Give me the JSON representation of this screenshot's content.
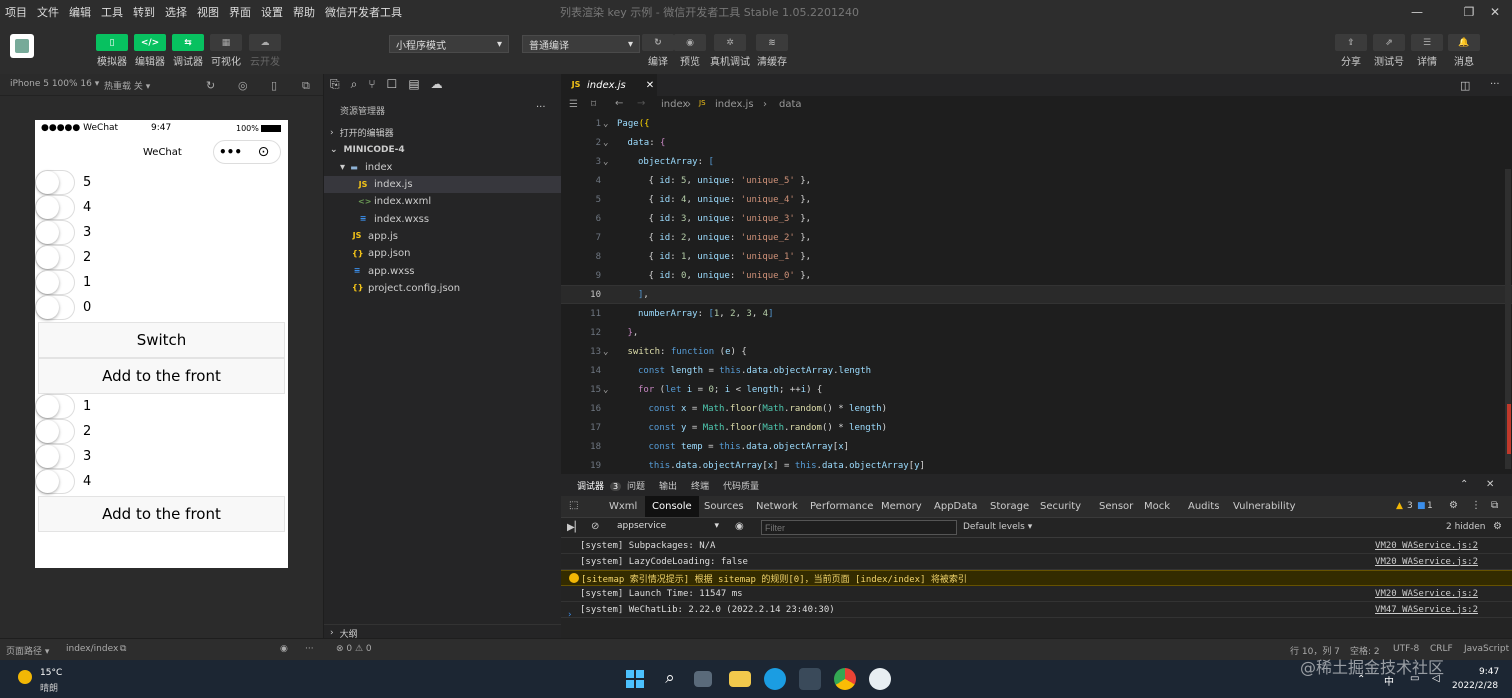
{
  "menu": [
    "项目",
    "文件",
    "编辑",
    "工具",
    "转到",
    "选择",
    "视图",
    "界面",
    "设置",
    "帮助",
    "微信开发者工具"
  ],
  "window_title": "列表渲染 key 示例 - 微信开发者工具 Stable 1.05.2201240",
  "toolbar": {
    "left": [
      {
        "label": "模拟器",
        "icon": "▯"
      },
      {
        "label": "编辑器",
        "icon": "</>"
      },
      {
        "label": "调试器",
        "icon": "⇆"
      },
      {
        "label": "可视化",
        "icon": "▦"
      },
      {
        "label": "云开发",
        "icon": "☁"
      }
    ],
    "mode_select": "小程序模式",
    "compile_select": "普通编译",
    "mid": [
      {
        "label": "编译",
        "icon": "↻"
      },
      {
        "label": "预览",
        "icon": "◉"
      },
      {
        "label": "真机调试",
        "icon": "✲"
      },
      {
        "label": "清缓存",
        "icon": "≋"
      }
    ],
    "right": [
      {
        "label": "分享",
        "icon": "⇪"
      },
      {
        "label": "测试号",
        "icon": "⇗"
      },
      {
        "label": "详情",
        "icon": "☰"
      },
      {
        "label": "消息",
        "icon": "🔔"
      }
    ]
  },
  "simbar": {
    "device": "iPhone 5 100% 16 ▾",
    "hotreload": "热重载 关 ▾"
  },
  "phone": {
    "carrier": "●●●●● WeChat",
    "time": "9:47",
    "battery": "100%",
    "nav_title": "WeChat",
    "list1": [
      "5",
      "4",
      "3",
      "2",
      "1",
      "0"
    ],
    "btn_switch": "Switch",
    "btn_add1": "Add to the front",
    "list2": [
      "1",
      "2",
      "3",
      "4"
    ],
    "btn_add2": "Add to the front"
  },
  "explorer": {
    "title": "资源管理器",
    "open_editors": "打开的编辑器",
    "project": "MINICODE-4",
    "folder": "index",
    "files": [
      {
        "name": "index.js",
        "icon": "JS",
        "color": "#f5c518",
        "indent": 2,
        "selected": true
      },
      {
        "name": "index.wxml",
        "icon": "<>",
        "color": "#6a9955",
        "indent": 2
      },
      {
        "name": "index.wxss",
        "icon": "≡",
        "color": "#3b8eea",
        "indent": 2
      },
      {
        "name": "app.js",
        "icon": "JS",
        "color": "#f5c518",
        "indent": 1
      },
      {
        "name": "app.json",
        "icon": "{}",
        "color": "#f5c518",
        "indent": 1
      },
      {
        "name": "app.wxss",
        "icon": "≡",
        "color": "#3b8eea",
        "indent": 1
      },
      {
        "name": "project.config.json",
        "icon": "{}",
        "color": "#f5c518",
        "indent": 1
      }
    ],
    "outline": "大纲"
  },
  "editor": {
    "tab": "index.js",
    "breadcrumb": [
      "index",
      "index.js",
      "data"
    ],
    "lines": [
      "1",
      "2",
      "3",
      "4",
      "5",
      "6",
      "7",
      "8",
      "9",
      "10",
      "11",
      "12",
      "13",
      "14",
      "15",
      "16",
      "17",
      "18",
      "19"
    ]
  },
  "debug": {
    "tabs1": [
      {
        "label": "调试器",
        "badge": "3"
      },
      {
        "label": "问题"
      },
      {
        "label": "输出"
      },
      {
        "label": "终端"
      },
      {
        "label": "代码质量"
      }
    ],
    "tabs2": [
      "Wxml",
      "Console",
      "Sources",
      "Network",
      "Performance",
      "Memory",
      "AppData",
      "Storage",
      "Security",
      "Sensor",
      "Mock",
      "Audits",
      "Vulnerability"
    ],
    "context": "appservice",
    "filter_placeholder": "Filter",
    "levels": "Default levels ▾",
    "hidden": "2 hidden",
    "warn_count": "3",
    "info_count": "1",
    "logs": [
      {
        "text": "[system] Subpackages: N/A",
        "src": "VM20 WAService.js:2",
        "warn": false
      },
      {
        "text": "[system] LazyCodeLoading: false",
        "src": "VM20 WAService.js:2",
        "warn": false
      },
      {
        "text": "[sitemap 索引情况提示] 根据 sitemap 的规则[0]，当前页面 [index/index] 将被索引",
        "src": "",
        "warn": true
      },
      {
        "text": "[system] Launch Time: 11547 ms",
        "src": "VM20 WAService.js:2",
        "warn": false
      },
      {
        "text": "[system] WeChatLib: 2.22.0 (2022.2.14 23:40:30)",
        "src": "VM47 WAService.js:2",
        "warn": false
      }
    ]
  },
  "status": {
    "path": "页面路径 ▾",
    "page": "index/index",
    "errors": "⊗ 0 ⚠ 0",
    "pos": "行 10，列 7",
    "spaces": "空格: 2",
    "enc": "UTF-8",
    "eol": "CRLF",
    "lang": "JavaScript"
  },
  "taskbar": {
    "temp": "15°C",
    "weather": "晴朗",
    "time": "9:47",
    "date": "2022/2/28",
    "ime": "中",
    "watermark": "@稀土掘金技术社区"
  }
}
